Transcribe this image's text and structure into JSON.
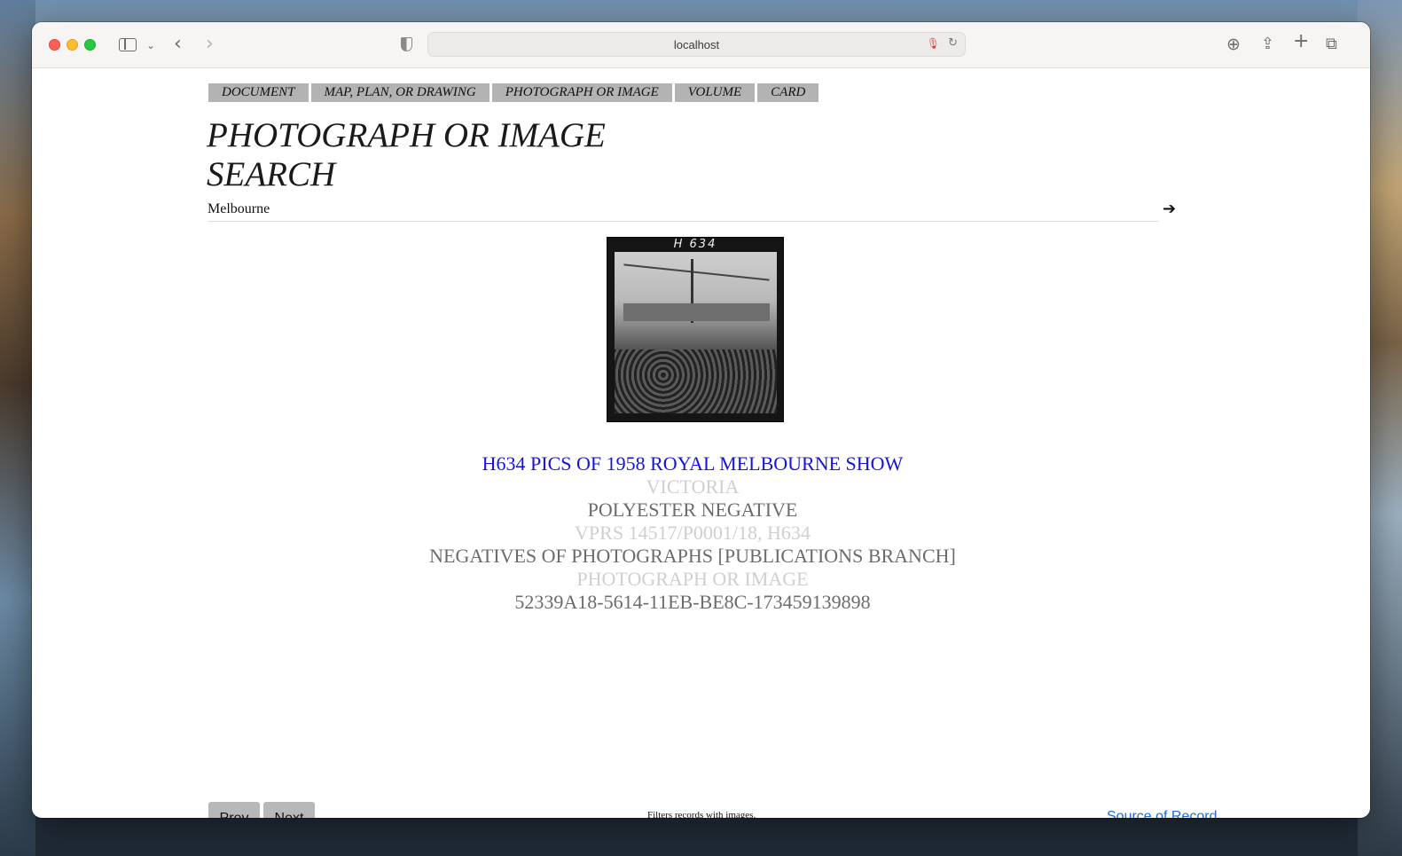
{
  "browser": {
    "url": "localhost",
    "icons": {
      "sidebar": "sidebar-icon",
      "chevron": "chevron-down-icon",
      "back": "back-arrow-icon",
      "forward": "forward-arrow-icon",
      "privacy": "shield-icon",
      "mic": "microphone-icon",
      "reload": "reload-icon",
      "download": "download-icon",
      "share": "share-icon",
      "new_tab": "plus-icon",
      "tabs": "tab-overview-icon"
    }
  },
  "type_tabs": [
    "DOCUMENT",
    "MAP, PLAN, OR DRAWING",
    "PHOTOGRAPH OR IMAGE",
    "VOLUME",
    "CARD"
  ],
  "page": {
    "title": "PHOTOGRAPH OR IMAGE SEARCH",
    "search_value": "Melbourne",
    "go_icon": "arrow-right-icon"
  },
  "result": {
    "thumbnail_code": "H 634",
    "title": "H634 PICS OF 1958 ROYAL MELBOURNE SHOW",
    "location": "VICTORIA",
    "format": "POLYESTER NEGATIVE",
    "citation": "VPRS 14517/P0001/18, H634",
    "series": "NEGATIVES OF PHOTOGRAPHS [PUBLICATIONS BRANCH]",
    "category": "PHOTOGRAPH OR IMAGE",
    "identifier": "52339A18-5614-11EB-BE8C-173459139898"
  },
  "footer": {
    "prev_label": "Prev",
    "next_label": "Next",
    "note": "Filters records with images.",
    "source_label": "Source of Record"
  },
  "colors": {
    "title_link": "#1414dc",
    "source_link": "#1c6ed6",
    "tab_bg": "#b3b3b3"
  }
}
